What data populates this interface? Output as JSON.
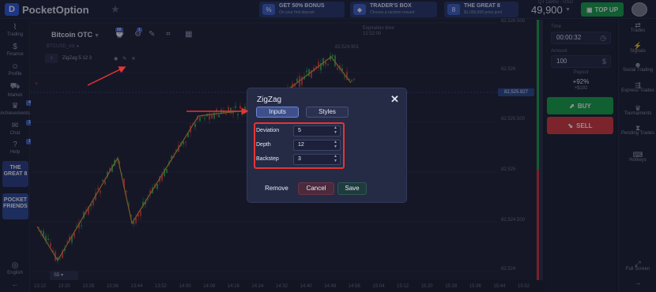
{
  "app": {
    "name": "PocketOption",
    "logo_glyph": "D"
  },
  "header": {
    "favorite_icon": "star-icon",
    "promos": [
      {
        "icon": "%",
        "title": "GET 50% BONUS",
        "subtitle": "On your first deposit"
      },
      {
        "icon": "◆",
        "title": "TRADER'S BOX",
        "subtitle": "Choose a random reward"
      },
      {
        "icon": "8",
        "title": "THE GREAT 8",
        "subtitle": "$1,000,000 prize pool"
      }
    ],
    "balance_label": "QT Demo · USD",
    "balance": "49,900",
    "topup_label": "TOP UP"
  },
  "left_nav": {
    "items": [
      {
        "icon": "chart-icon",
        "glyph": "⌇",
        "label": "Trading"
      },
      {
        "icon": "dollar-icon",
        "glyph": "$",
        "label": "Finance"
      },
      {
        "icon": "user-icon",
        "glyph": "☺",
        "label": "Profile"
      },
      {
        "icon": "cart-icon",
        "glyph": "⛟",
        "label": "Market"
      },
      {
        "icon": "trophy-icon",
        "glyph": "♛",
        "label": "Achievements",
        "badge": "4"
      },
      {
        "icon": "chat-icon",
        "glyph": "✉",
        "label": "Chat",
        "badge": "1"
      },
      {
        "icon": "help-icon",
        "glyph": "?",
        "label": "Help",
        "badge": "1"
      }
    ],
    "promo_boxes": [
      "THE GREAT 8",
      "POCKET FRIENDS"
    ],
    "bottom_label": "English"
  },
  "chart_toolbar": {
    "asset": "Bitcoin OTC",
    "badges": [
      "88",
      "1"
    ],
    "symbol_line": "BTCUSD_otc ●",
    "indicator_label": "ZigZag 5 12 3",
    "expiration_label": "Expiration time",
    "expiration_value": "12:52:00"
  },
  "price_axis": {
    "labels": [
      "82,526.500",
      "82,526",
      "82,525.500",
      "82,525",
      "82,524.500",
      "82,524"
    ],
    "current": "82,525.827",
    "peak_label": "82,524.901"
  },
  "time_axis": [
    "13:12",
    "13:20",
    "13:28",
    "13:36",
    "13:44",
    "13:52",
    "14:00",
    "14:08",
    "14:16",
    "14:24",
    "14:32",
    "14:40",
    "14:48",
    "14:56",
    "15:04",
    "15:12",
    "15:20",
    "15:28",
    "15:36",
    "15:44",
    "15:52"
  ],
  "timeframe": "S5",
  "trade_panel": {
    "time_label": "Time",
    "time_value": "00:00:32",
    "amount_label": "Amount",
    "amount_value": "100",
    "payout_label": "Payout",
    "payout_pct": "+92%",
    "payout_value": "+$192",
    "buy_label": "BUY",
    "sell_label": "SELL"
  },
  "right_nav": {
    "items": [
      "Trades",
      "Signals",
      "Social Trading",
      "Express Trades",
      "Tournaments",
      "Pending Trades",
      "Hotkeys"
    ],
    "bottom": "Full Screen"
  },
  "modal": {
    "title": "ZigZag",
    "close_glyph": "✕",
    "tabs": [
      "Inputs",
      "Styles"
    ],
    "params": [
      {
        "label": "Deviation",
        "value": "5"
      },
      {
        "label": "Depth",
        "value": "12"
      },
      {
        "label": "Backstep",
        "value": "3"
      }
    ],
    "remove_label": "Remove",
    "cancel_label": "Cancel",
    "save_label": "Save"
  },
  "colors": {
    "background": "#1a1e2e",
    "accent": "#3f63c9",
    "buy": "#14a748",
    "sell": "#d7393c",
    "zigzag": "#d79b39",
    "annotation": "#e53535"
  }
}
